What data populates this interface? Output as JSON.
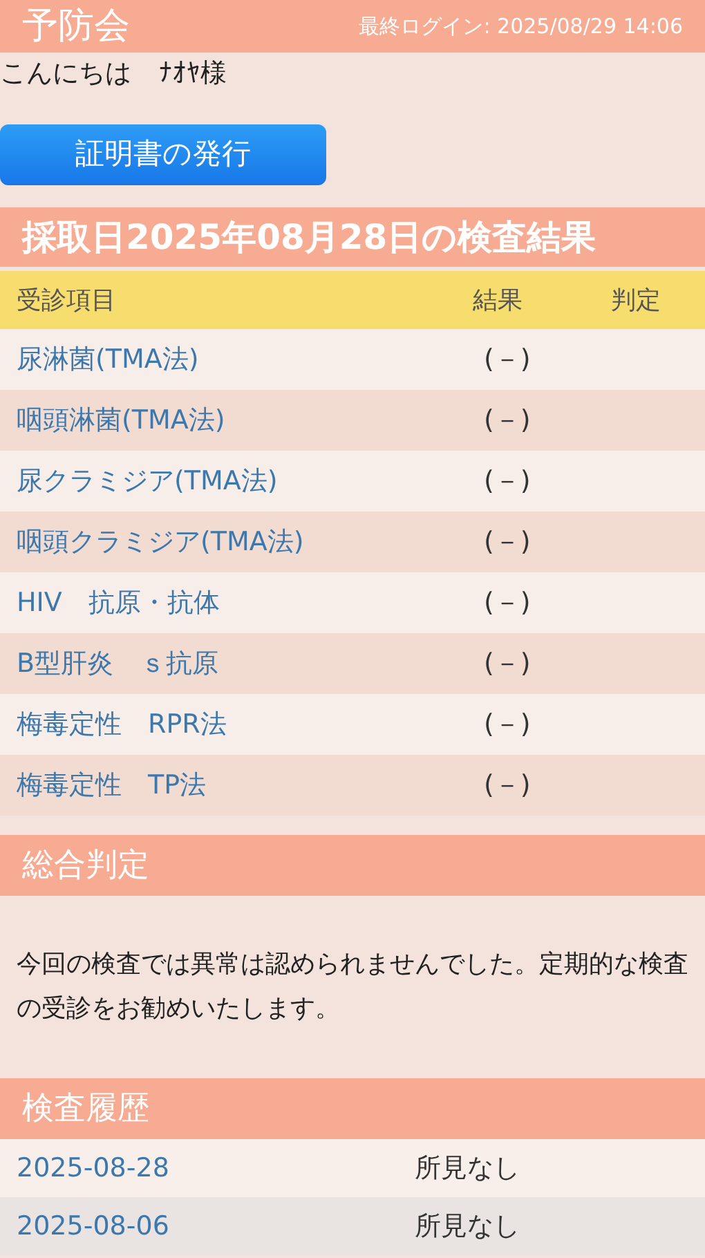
{
  "header": {
    "title": "予防会",
    "last_login": "最終ログイン: 2025/08/29 14:06"
  },
  "greeting": {
    "text": "こんにちは",
    "name": "ﾅｵﾔ様"
  },
  "certificate_button": {
    "label": "証明書の発行"
  },
  "results": {
    "title": "採取日2025年08月28日の検査結果",
    "columns": [
      "受診項目",
      "結果",
      "判定"
    ],
    "rows": [
      {
        "item": "尿淋菌(TMA法)",
        "result": "(－)"
      },
      {
        "item": "咽頭淋菌(TMA法)",
        "result": "(－)"
      },
      {
        "item": "尿クラミジア(TMA法)",
        "result": "(－)"
      },
      {
        "item": "咽頭クラミジア(TMA法)",
        "result": "(－)"
      },
      {
        "item": "HIV　抗原・抗体",
        "result": "(－)"
      },
      {
        "item": "B型肝炎　ｓ抗原",
        "result": "(－)"
      },
      {
        "item": "梅毒定性　RPR法",
        "result": "(－)"
      },
      {
        "item": "梅毒定性　TP法",
        "result": "(－)"
      }
    ]
  },
  "overall": {
    "title": "総合判定",
    "text": "今回の検査では異常は認められませんでした。定期的な検査の受診をお勧めいたします。"
  },
  "history": {
    "title": "検査履歴",
    "rows": [
      {
        "date": "2025-08-28",
        "finding": "所見なし"
      },
      {
        "date": "2025-08-06",
        "finding": "所見なし"
      }
    ]
  }
}
